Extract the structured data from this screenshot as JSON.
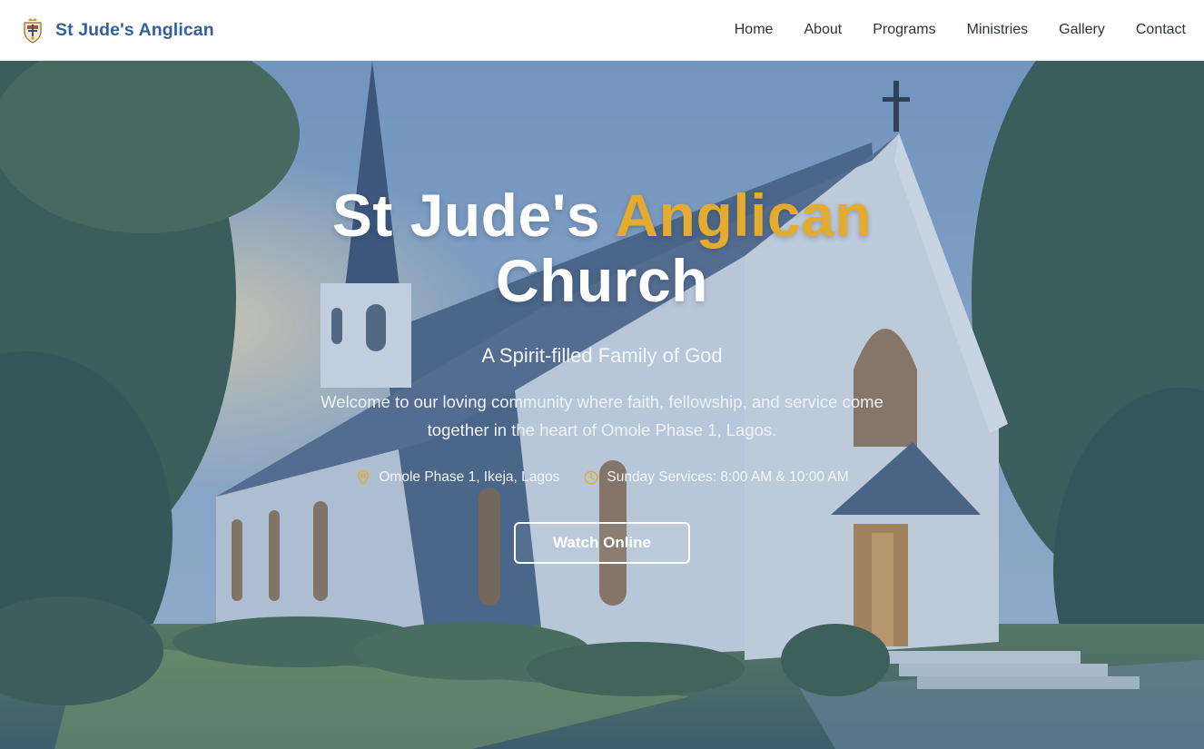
{
  "brand": {
    "name": "St Jude's Anglican"
  },
  "nav": {
    "items": [
      {
        "label": "Home"
      },
      {
        "label": "About"
      },
      {
        "label": "Programs"
      },
      {
        "label": "Ministries"
      },
      {
        "label": "Gallery"
      },
      {
        "label": "Contact"
      }
    ]
  },
  "hero": {
    "title_part1": "St Jude's",
    "title_accent": "Anglican",
    "title_part2": "Church",
    "subtitle": "A Spirit-filled Family of God",
    "welcome": "Welcome to our loving community where faith, fellowship, and service come together in the heart of Omole Phase 1, Lagos.",
    "location": "Omole Phase 1, Ikeja, Lagos",
    "services": "Sunday Services: 8:00 AM & 10:00 AM",
    "cta_label": "Watch Online"
  },
  "icons": {
    "brand": "church-crest-icon",
    "location": "map-pin-icon",
    "services": "clock-icon"
  },
  "colors": {
    "brand": "#355f9e",
    "accent": "#e4ab2e",
    "nav_text": "#2d3440",
    "hero_overlay": "#3a5c8c"
  }
}
